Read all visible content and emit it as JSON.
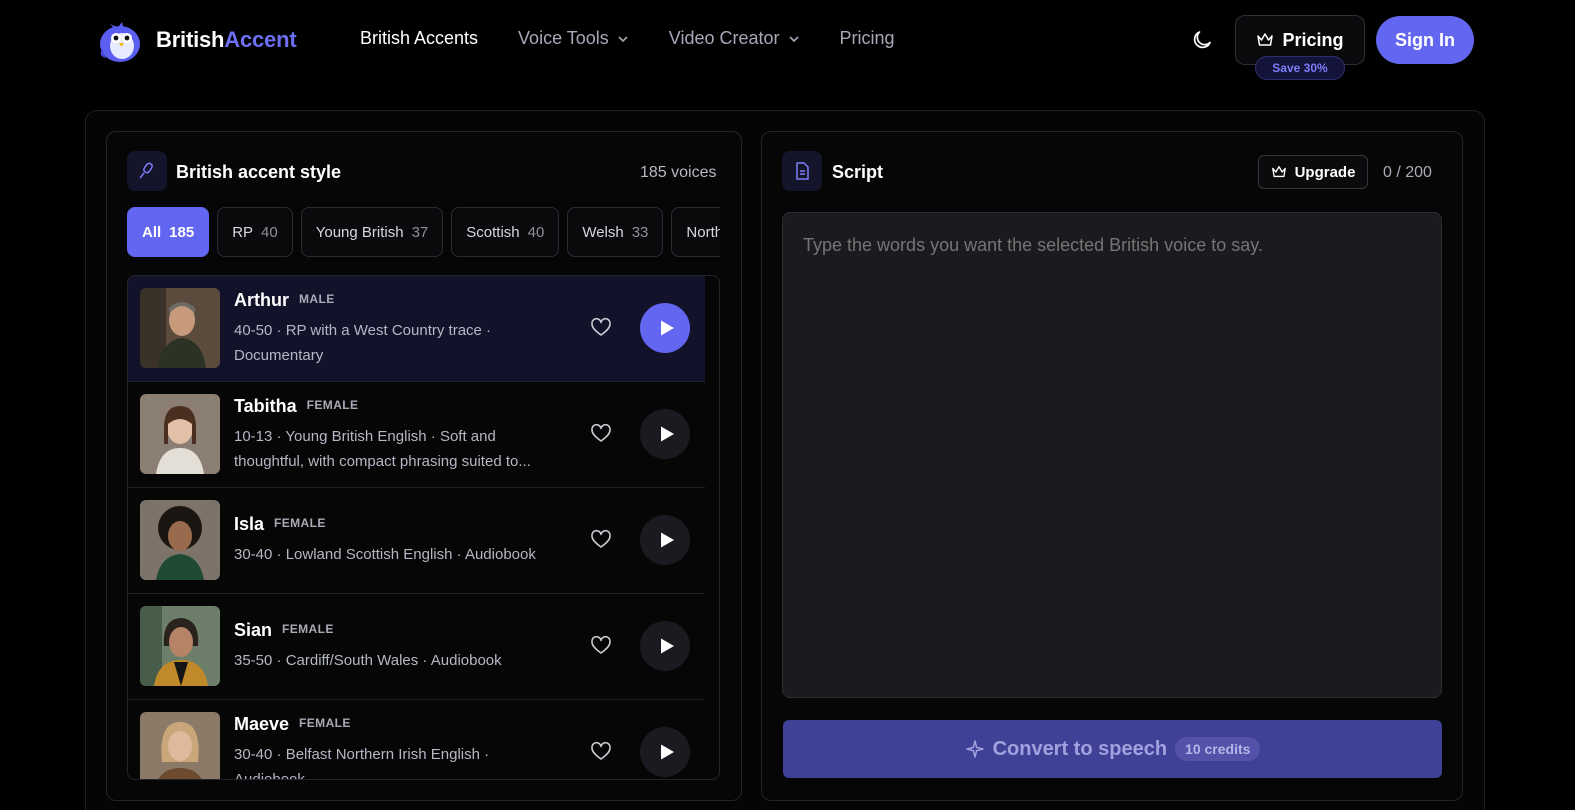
{
  "brand": {
    "name_part1": "British",
    "name_part2": "Accent"
  },
  "nav": [
    {
      "label": "British Accents",
      "active": true,
      "dropdown": false
    },
    {
      "label": "Voice Tools",
      "active": false,
      "dropdown": true
    },
    {
      "label": "Video Creator",
      "active": false,
      "dropdown": true
    },
    {
      "label": "Pricing",
      "active": false,
      "dropdown": false
    }
  ],
  "header": {
    "pricing_label": "Pricing",
    "save_badge": "Save 30%",
    "signin_label": "Sign In"
  },
  "left_panel": {
    "title": "British accent style",
    "voice_count": "185 voices",
    "chips": [
      {
        "label": "All",
        "count": "185",
        "active": true
      },
      {
        "label": "RP",
        "count": "40",
        "active": false
      },
      {
        "label": "Young British",
        "count": "37",
        "active": false
      },
      {
        "label": "Scottish",
        "count": "40",
        "active": false
      },
      {
        "label": "Welsh",
        "count": "33",
        "active": false
      },
      {
        "label": "Northern",
        "count": "",
        "active": false
      }
    ],
    "voices": [
      {
        "name": "Arthur",
        "gender": "MALE",
        "desc_line1": "40-50 · RP with a West Country trace ·",
        "desc_line2": "Documentary",
        "selected": true
      },
      {
        "name": "Tabitha",
        "gender": "FEMALE",
        "desc_line1": "10-13 · Young British English · Soft and",
        "desc_line2": "thoughtful, with compact phrasing suited to...",
        "selected": false
      },
      {
        "name": "Isla",
        "gender": "FEMALE",
        "desc_line1": "30-40 · Lowland Scottish English · Audiobook",
        "desc_line2": "",
        "selected": false
      },
      {
        "name": "Sian",
        "gender": "FEMALE",
        "desc_line1": "35-50 · Cardiff/South Wales · Audiobook",
        "desc_line2": "",
        "selected": false
      },
      {
        "name": "Maeve",
        "gender": "FEMALE",
        "desc_line1": "30-40 · Belfast Northern Irish English ·",
        "desc_line2": "Audiobook",
        "selected": false
      }
    ]
  },
  "right_panel": {
    "title": "Script",
    "upgrade_label": "Upgrade",
    "char_count": "0 / 200",
    "placeholder": "Type the words you want the selected British voice to say.",
    "convert_label": "Convert to speech",
    "credits_label": "10 credits"
  },
  "colors": {
    "accent": "#6366f1",
    "background": "#000000",
    "panel": "#060607"
  }
}
